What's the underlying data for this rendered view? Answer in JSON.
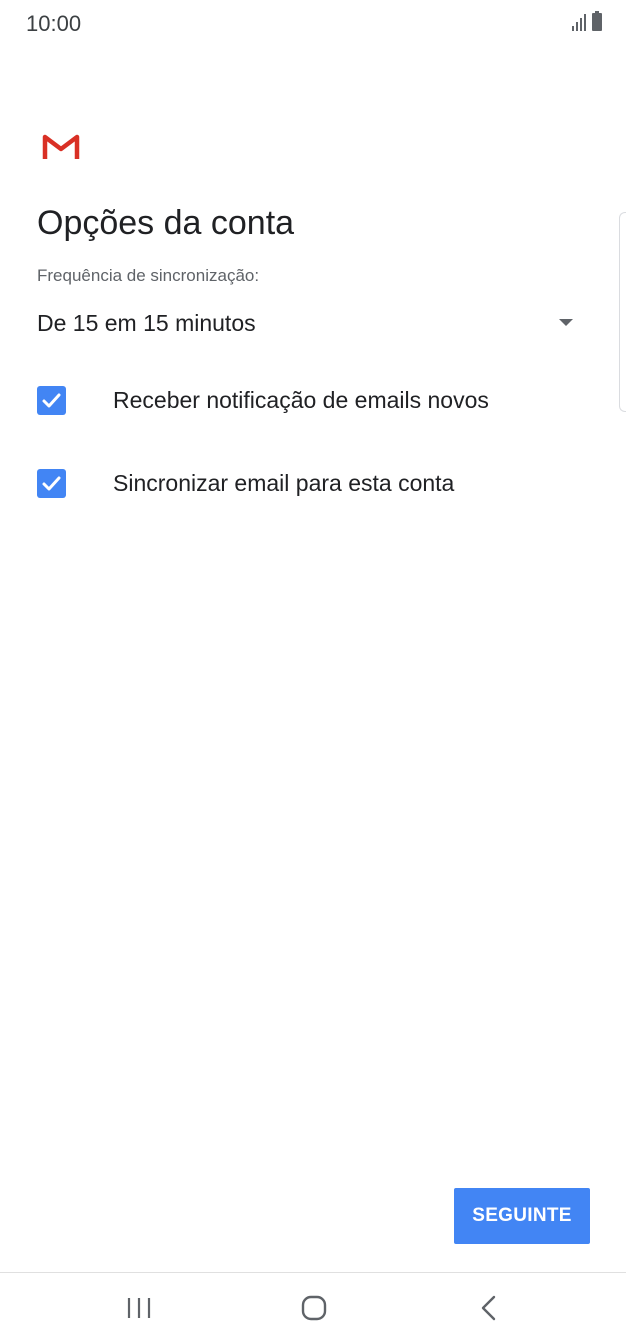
{
  "status_bar": {
    "time": "10:00",
    "icons": [
      "signal-icon",
      "battery-icon"
    ]
  },
  "app": {
    "logo_icon": "gmail-logo-icon",
    "brand_color": "#d93025"
  },
  "page": {
    "title": "Opções da conta",
    "sync_frequency_label": "Frequência de sincronização:",
    "sync_frequency_value": "De 15 em 15 minutos"
  },
  "options": [
    {
      "label": "Receber notificação de emails novos",
      "checked": true
    },
    {
      "label": "Sincronizar email para esta conta",
      "checked": true
    }
  ],
  "actions": {
    "next_label": "SEGUINTE",
    "accent_color": "#4285f4"
  },
  "navigation": {
    "buttons": [
      "recent-apps-icon",
      "home-icon",
      "back-icon"
    ]
  }
}
